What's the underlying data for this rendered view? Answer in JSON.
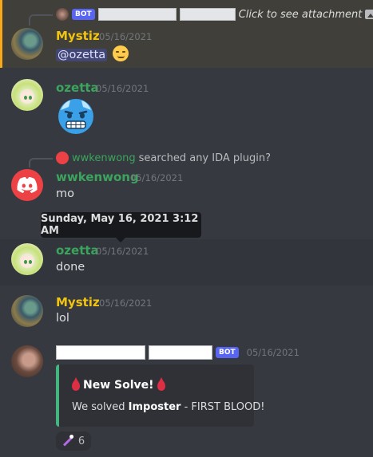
{
  "messages": [
    {
      "reply": {
        "bot_tag": "BOT",
        "attachment_text": "Click to see attachment"
      },
      "username": "Mystiz",
      "username_color": "#f1c40f",
      "timestamp": "05/16/2021",
      "mention": "@ozetta"
    },
    {
      "username": "ozetta",
      "username_color": "#3ba55d",
      "timestamp": "05/16/2021",
      "emoji": "cold-face-emoji"
    },
    {
      "reply": {
        "author": "wwkenwong",
        "text": "searched any IDA plugin?"
      },
      "username": "wwkenwong",
      "username_color": "#3ba55d",
      "timestamp": "05/16/2021",
      "text": "mo"
    },
    {
      "username": "ozetta",
      "username_color": "#3ba55d",
      "timestamp": "05/16/2021",
      "text": "done"
    },
    {
      "username": "Mystiz",
      "username_color": "#f1c40f",
      "timestamp": "05/16/2021",
      "text": "lol"
    },
    {
      "bot_tag": "BOT",
      "timestamp": "05/16/2021",
      "embed": {
        "title": "New Solve!",
        "desc_prefix": "We solved ",
        "desc_bold": "Imposter",
        "desc_suffix": " - FIRST BLOOD!",
        "accent": "#43b581"
      },
      "reaction": {
        "emoji": "magic-wand-emoji",
        "count": "6"
      }
    }
  ],
  "tooltip": "Sunday, May 16, 2021 3:12 AM",
  "colors": {
    "background": "#36393f",
    "highlight_bar": "#faa81a"
  }
}
